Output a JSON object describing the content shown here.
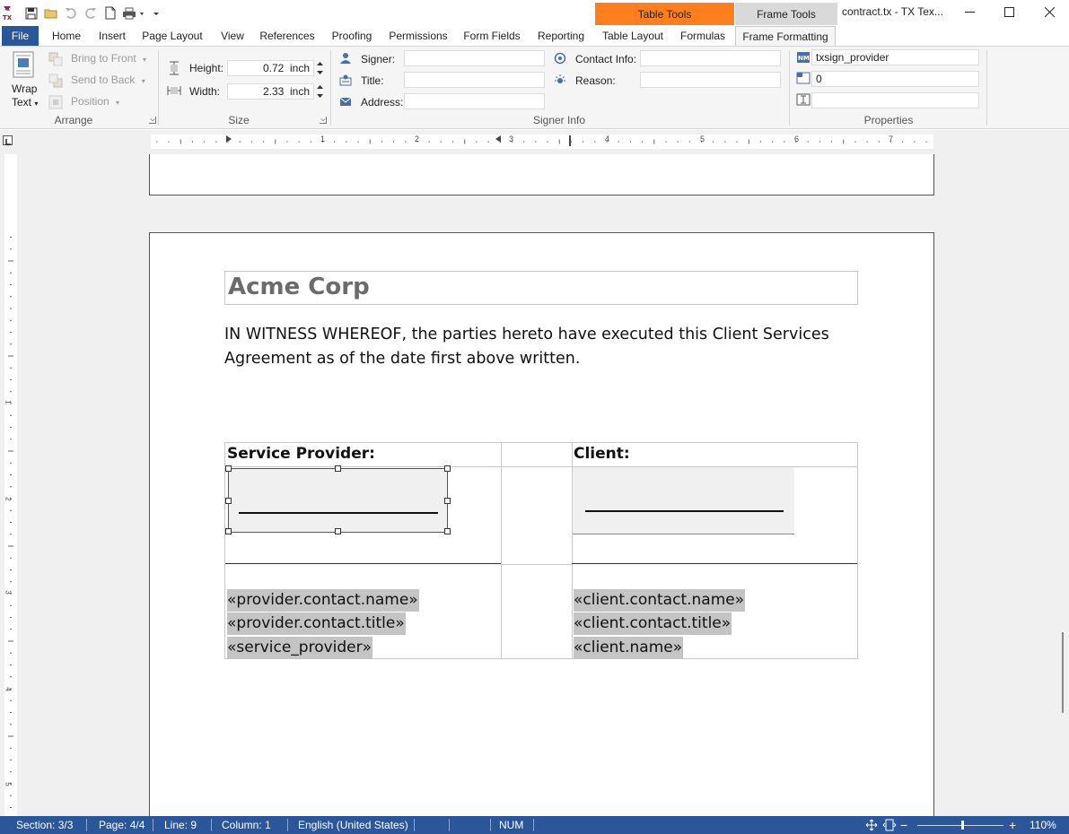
{
  "window": {
    "title": "contract.tx - TX Tex...",
    "contextual_tabs": [
      "Table Tools",
      "Frame Tools"
    ]
  },
  "tabs": [
    "File",
    "Home",
    "Insert",
    "Page Layout",
    "View",
    "References",
    "Proofing",
    "Permissions",
    "Form Fields",
    "Reporting",
    "Table Layout",
    "Formulas",
    "Frame Formatting"
  ],
  "ribbon": {
    "arrange": {
      "wrap_text": "Wrap",
      "wrap_text2": "Text",
      "bring_to_front": "Bring to Front",
      "send_to_back": "Send to Back",
      "position": "Position",
      "label": "Arrange"
    },
    "size": {
      "height_label": "Height:",
      "height_value": "0.72",
      "width_label": "Width:",
      "width_value": "2.33",
      "unit": "inch",
      "label": "Size"
    },
    "signer_info": {
      "signer": "Signer:",
      "title": "Title:",
      "address": "Address:",
      "contact_info": "Contact Info:",
      "reason": "Reason:",
      "label": "Signer Info"
    },
    "properties": {
      "name_value": "txsign_provider",
      "id_value": "0",
      "label": "Properties"
    }
  },
  "ruler": {
    "numbers": [
      "1",
      "2",
      "3",
      "4",
      "5",
      "6",
      "7"
    ],
    "vnumbers": [
      "1",
      "2",
      "3",
      "4",
      "5"
    ]
  },
  "document": {
    "heading": "Acme Corp",
    "paragraph": "IN WITNESS WHEREOF, the parties hereto have executed this Client Services Agreement as of the date first above written.",
    "table": {
      "provider_header": "Service Provider:",
      "client_header": "Client:",
      "provider_fields": [
        "«provider.contact.name»",
        "«provider.contact.title»",
        "«service_provider»"
      ],
      "client_fields": [
        "«client.contact.name»",
        "«client.contact.title»",
        "«client.name»"
      ]
    }
  },
  "status": {
    "section": "Section: 3/3",
    "page": "Page: 4/4",
    "line": "Line: 9",
    "column": "Column: 1",
    "language": "English (United States)",
    "num": "NUM",
    "zoom": "110%",
    "zoom_value_percent": 110
  },
  "colors": {
    "accent_blue": "#2b579a",
    "table_tools_orange": "#ff7f1e",
    "field_gray": "#c4c4c4"
  }
}
